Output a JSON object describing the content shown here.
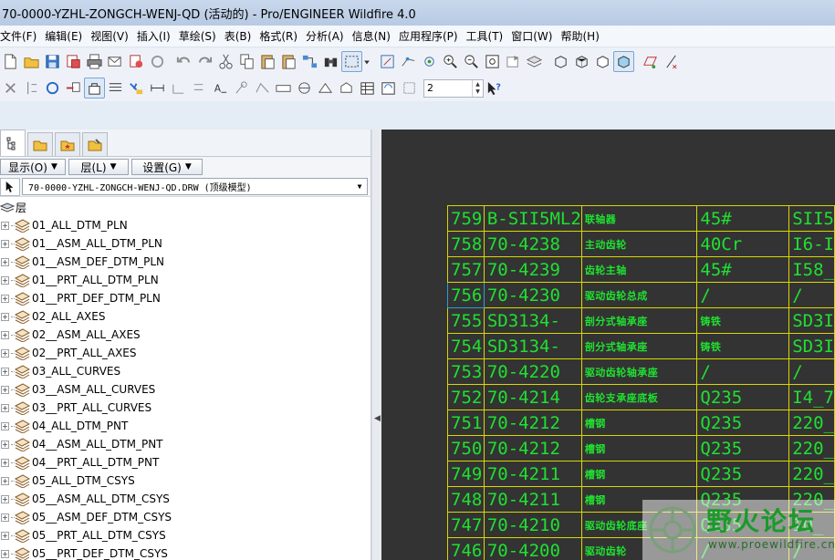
{
  "window": {
    "title": "70-0000-YZHL-ZONGCH-WENJ-QD (活动的) - Pro/ENGINEER Wildfire 4.0"
  },
  "menu": [
    "文件(F)",
    "编辑(E)",
    "视图(V)",
    "插入(I)",
    "草绘(S)",
    "表(B)",
    "格式(R)",
    "分析(A)",
    "信息(N)",
    "应用程序(P)",
    "工具(T)",
    "窗口(W)",
    "帮助(H)"
  ],
  "toolbar2": {
    "spin_value": "2"
  },
  "navigator": {
    "buttons": {
      "show": "显示(O)",
      "layer": "层(L)",
      "settings": "设置(G)"
    },
    "model": "70-0000-YZHL-ZONGCH-WENJ-QD.DRW (顶级模型)",
    "root": "层",
    "layers": [
      "01_ALL_DTM_PLN",
      "01__ASM_ALL_DTM_PLN",
      "01__ASM_DEF_DTM_PLN",
      "01__PRT_ALL_DTM_PLN",
      "01__PRT_DEF_DTM_PLN",
      "02_ALL_AXES",
      "02__ASM_ALL_AXES",
      "02__PRT_ALL_AXES",
      "03_ALL_CURVES",
      "03__ASM_ALL_CURVES",
      "03__PRT_ALL_CURVES",
      "04_ALL_DTM_PNT",
      "04__ASM_ALL_DTM_PNT",
      "04__PRT_ALL_DTM_PNT",
      "05_ALL_DTM_CSYS",
      "05__ASM_ALL_DTM_CSYS",
      "05__ASM_DEF_DTM_CSYS",
      "05__PRT_ALL_DTM_CSYS",
      "05__PRT_DEF_DTM_CSYS"
    ]
  },
  "bom": [
    [
      "759",
      "B-SII5ML2",
      "联轴器",
      "45#",
      "SII5"
    ],
    [
      "758",
      "70-4238",
      "主动齿轮",
      "40Cr",
      "I6-I"
    ],
    [
      "757",
      "70-4239",
      "齿轮主轴",
      "45#",
      "I58_"
    ],
    [
      "756",
      "70-4230",
      "驱动齿轮总成",
      "/",
      "/"
    ],
    [
      "755",
      "SD3134-",
      "剖分式轴承座",
      "铸铁",
      "SD3I"
    ],
    [
      "754",
      "SD3134-",
      "剖分式轴承座",
      "铸铁",
      "SD3I"
    ],
    [
      "753",
      "70-4220",
      "驱动齿轮轴承座",
      "/",
      "/"
    ],
    [
      "752",
      "70-4214",
      "齿轮支承座底板",
      "Q235",
      "I4_7"
    ],
    [
      "751",
      "70-4212",
      "槽钢",
      "Q235",
      "220_"
    ],
    [
      "750",
      "70-4212",
      "槽钢",
      "Q235",
      "220_"
    ],
    [
      "749",
      "70-4211",
      "槽钢",
      "Q235",
      "220_"
    ],
    [
      "748",
      "70-4211",
      "槽钢",
      "Q235",
      "220_"
    ],
    [
      "747",
      "70-4210",
      "驱动齿轮底座",
      "Q235",
      "I0_"
    ],
    [
      "746",
      "70-4200",
      "驱动齿轮",
      "/",
      "/"
    ]
  ],
  "watermark": {
    "title": "野火论坛",
    "url": "www.proewildfire.cn"
  },
  "colors": {
    "graphics_bg": "#333333",
    "table_lines": "#d8d800",
    "table_text": "#20e030",
    "selected_cell": "#2aa0d0"
  }
}
